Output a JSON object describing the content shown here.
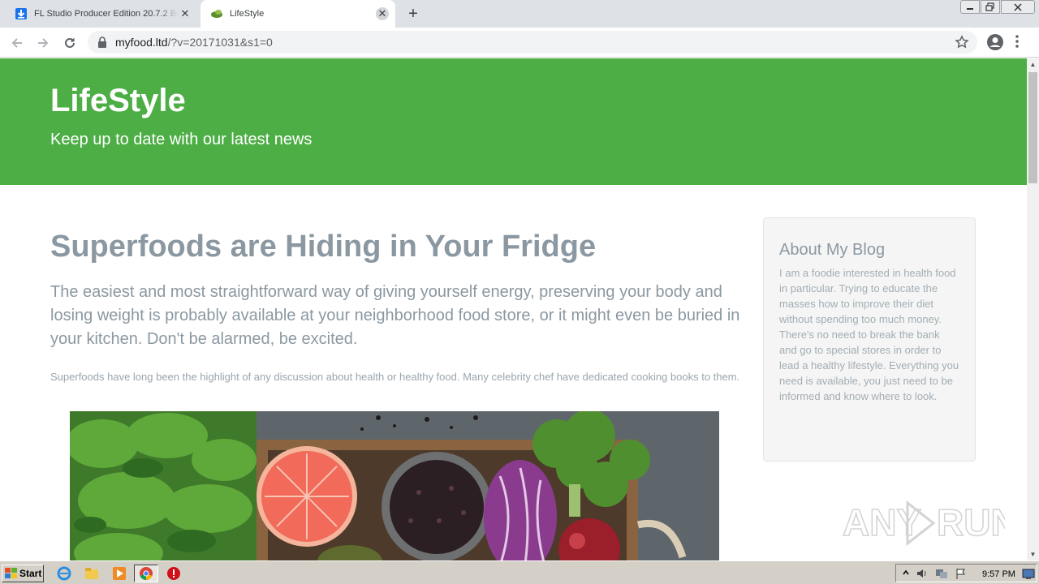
{
  "browser": {
    "tabs": [
      {
        "title": "FL Studio Producer Edition 20.7.2 Bu",
        "active": false
      },
      {
        "title": "LifeStyle",
        "active": true
      }
    ],
    "new_tab_label": "+",
    "url_host": "myfood.ltd",
    "url_path": "/?v=20171031&s1=0"
  },
  "page": {
    "site_title": "LifeStyle",
    "tagline": "Keep up to date with our latest news",
    "article": {
      "title": "Superfoods are Hiding in Your Fridge",
      "lead": "The easiest and most straightforward way of giving yourself energy, preserving your body and losing weight is probably available at your neighborhood food store, or it might even be buried in your kitchen. Don't be alarmed, be excited.",
      "body": "Superfoods have long been the highlight of any discussion about health or healthy food. Many celebrity chef have dedicated cooking books to them."
    },
    "sidebar": {
      "heading": "About My Blog",
      "text": "I am a foodie interested in health food in particular. Trying to educate the masses how to improve their diet without spending too much money. There's no need to break the bank and go to special stores in order to lead a healthy lifestyle. Everything you need is available, you just need to be informed and know where to look."
    },
    "watermark": "ANY RUN"
  },
  "taskbar": {
    "start_label": "Start",
    "clock": "9:57 PM"
  },
  "colors": {
    "hero_green": "#4cae44",
    "text_gray": "#8b98a1",
    "sidebar_bg": "#f5f5f5"
  }
}
